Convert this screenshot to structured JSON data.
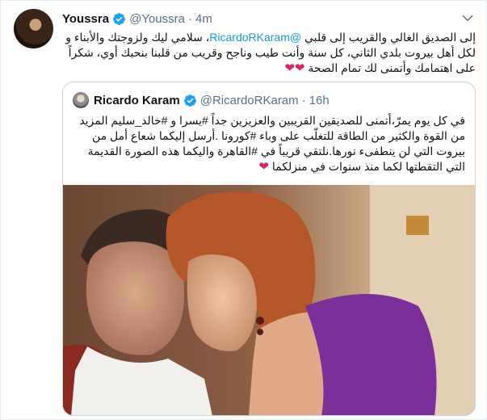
{
  "tweet": {
    "author_name": "Youssra",
    "author_handle": "@Youssra",
    "separator": "·",
    "time": "4m",
    "text_before_mention": "إلى الصديق الغالي والقريب إلى قلبي ",
    "mention": "@RicardoRKaram",
    "text_after_mention": "، سلامي ليك ولزوجتك والأبناء و لكل أهل بيروت بلدي الثاني، كل سنة وأنت طيب وناجح وقريب من قلبنا بنحبك أوي، شكراً على اهتمامك  وأتمنى لك تمام الصحة",
    "hearts": "❤❤"
  },
  "quoted": {
    "author_name": "Ricardo Karam",
    "author_handle": "@RicardoRKaram",
    "separator": "·",
    "time": "16h",
    "text": "في كل يوم يمرّ،أتمنى للصديقين القريبين والعزيزين جداً #يسرا و #خالد_سليم المزيد من القوة والكثير من الطاقة للتغلّب على وباء #كورونا .أرسل إليكما شعاع أمل من بيروت التي لن ينطفىء نورها.نلتقي قريباً في #القاهرة واليكما هذه الصورة القديمة التي التقطتها لكما منذ سنوات في منزلكما",
    "heart": "❤"
  },
  "icons": {
    "verified": "verified-badge-icon",
    "menu": "chevron-down-icon"
  },
  "colors": {
    "link": "#1b95e0",
    "muted": "#5b7083",
    "heart": "#e0245e",
    "border": "#ccd6dd"
  }
}
